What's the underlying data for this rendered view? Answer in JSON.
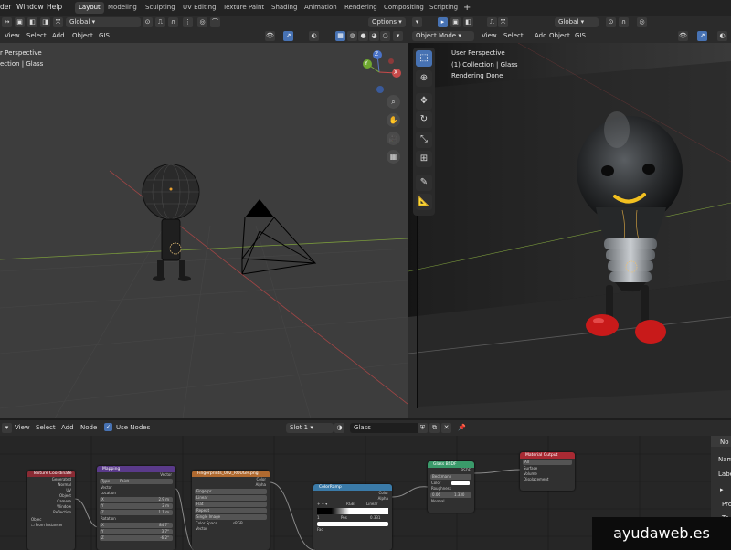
{
  "topbar": {
    "menus": [
      "der",
      "Window",
      "Help"
    ],
    "workspaces": [
      "Layout",
      "Modeling",
      "Sculpting",
      "UV Editing",
      "Texture Paint",
      "Shading",
      "Animation",
      "Rendering",
      "Compositing",
      "Scripting"
    ],
    "active_workspace": "Layout",
    "add_tab": "+"
  },
  "left_header": {
    "orientation": "Global",
    "options": "Options",
    "menus": [
      "View",
      "Select",
      "Add",
      "Object",
      "GIS"
    ]
  },
  "left_viewport": {
    "title": "r Perspective",
    "collection": "ection | Glass",
    "gizmo": {
      "x": "X",
      "y": "Y",
      "z": "Z"
    }
  },
  "right_header": {
    "orientation": "Global",
    "mode": "Object Mode",
    "menus": [
      "View",
      "Select",
      "Add",
      "Object",
      "GIS"
    ]
  },
  "right_viewport": {
    "title": "User Perspective",
    "collection": "(1) Collection | Glass",
    "status": "Rendering Done"
  },
  "node_header": {
    "menus": [
      "View",
      "Select",
      "Add",
      "Node"
    ],
    "use_nodes": "Use Nodes",
    "slot": "Slot 1",
    "material": "Glass"
  },
  "nodes": {
    "texcoord": {
      "title": "Texture Coordinate",
      "outputs": [
        "Generated",
        "Normal",
        "UV",
        "Object",
        "Camera",
        "Window",
        "Reflection"
      ],
      "object_label": "Objec",
      "instancer": "From Instancer"
    },
    "mapping": {
      "title": "Mapping",
      "output": "Vector",
      "type_label": "Type",
      "type_value": "Point",
      "vector": "Vector",
      "location": "Location",
      "loc": [
        [
          "X",
          "2.9 m"
        ],
        [
          "Y",
          "2 m"
        ],
        [
          "Z",
          "1.1 m"
        ]
      ],
      "rotation": "Rotation",
      "rot": [
        [
          "X",
          "84.7°"
        ],
        [
          "Y",
          "3.7°"
        ],
        [
          "Z",
          "-6.2°"
        ]
      ]
    },
    "image": {
      "title": "Fingerprints_002_ROUGH.png",
      "outputs": [
        "Color",
        "Alpha"
      ],
      "file": "Fingerpr…",
      "interp": "Linear",
      "proj": "Flat",
      "ext": "Repeat",
      "source": "Single Image",
      "cs_label": "Color Space",
      "cs_value": "sRGB",
      "vector": "Vector"
    },
    "ramp": {
      "title": "ColorRamp",
      "outputs": [
        "Color",
        "Alpha"
      ],
      "mode": "RGB",
      "interp": "Linear",
      "index": "1",
      "pos_label": "Pos",
      "pos_value": "0.331",
      "fac": "Fac"
    },
    "glass": {
      "title": "Glass BSDF",
      "output": "BSDF",
      "dist": "Beckmann",
      "color": "Color",
      "roughness": "Roughness",
      "r_val": "0.06",
      "ior": "1.330",
      "normal": "Normal"
    },
    "output": {
      "title": "Material Output",
      "target": "All",
      "inputs": [
        "Surface",
        "Volume",
        "Displacement"
      ]
    }
  },
  "npanel": {
    "labels": [
      "No",
      "Nam",
      "Labe",
      "Pro",
      "Te",
      "Te"
    ]
  },
  "watermark": "ayudaweb.es",
  "colors": {
    "accent": "#4772b3",
    "header": "#2b2b2b",
    "viewport": "#3d3d3d"
  }
}
